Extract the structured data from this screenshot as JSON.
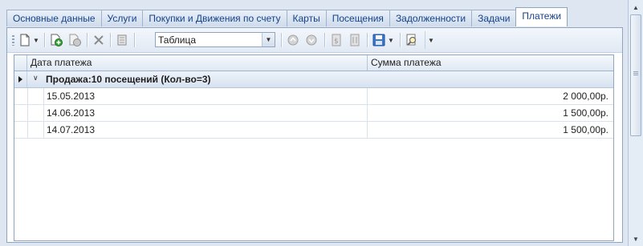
{
  "tabs": [
    {
      "label": "Основные данные"
    },
    {
      "label": "Услуги"
    },
    {
      "label": "Покупки и Движения по счету"
    },
    {
      "label": "Карты"
    },
    {
      "label": "Посещения"
    },
    {
      "label": "Задолженности"
    },
    {
      "label": "Задачи"
    },
    {
      "label": "Платежи",
      "active": true
    }
  ],
  "toolbar": {
    "view_select": "Таблица",
    "icons": [
      "new-document-icon",
      "add-icon",
      "copy-icon",
      "delete-icon",
      "print-icon",
      "move-up-icon",
      "move-down-icon",
      "export-icon",
      "import-icon",
      "save-icon",
      "search-icon",
      "overflow-icon"
    ]
  },
  "grid": {
    "columns": [
      "Дата платежа",
      "Сумма платежа"
    ],
    "group": {
      "title": "Продажа:10 посещений (Кол-во=3)"
    },
    "rows": [
      {
        "date": "15.05.2013",
        "amount": "2 000,00р."
      },
      {
        "date": "14.06.2013",
        "amount": "1 500,00р."
      },
      {
        "date": "14.07.2013",
        "amount": "1 500,00р."
      }
    ]
  },
  "colors": {
    "accent": "#15428b",
    "border": "#8ea4c1",
    "background": "#dfe7f1"
  }
}
